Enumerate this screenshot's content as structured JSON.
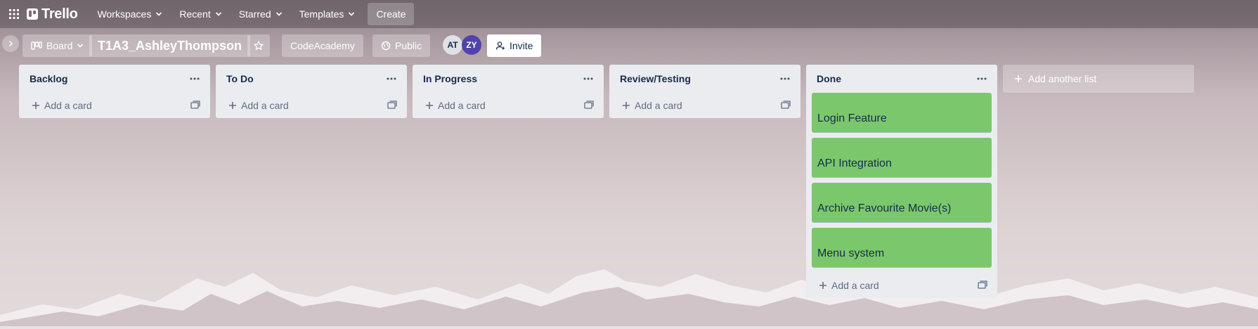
{
  "nav": {
    "logo_text": "Trello",
    "items": [
      {
        "label": "Workspaces"
      },
      {
        "label": "Recent"
      },
      {
        "label": "Starred"
      },
      {
        "label": "Templates"
      }
    ],
    "create_label": "Create"
  },
  "board": {
    "view_label": "Board",
    "title": "T1A3_AshleyThompson",
    "workspace_label": "CodeAcademy",
    "visibility_label": "Public",
    "members": [
      {
        "initials": "AT",
        "color": "#dfe1e6",
        "text_color": "#172b4d"
      },
      {
        "initials": "ZY",
        "color": "#5243aa",
        "text_color": "#ffffff"
      }
    ],
    "invite_label": "Invite"
  },
  "lists": [
    {
      "title": "Backlog",
      "cards": [],
      "add_label": "Add a card"
    },
    {
      "title": "To Do",
      "cards": [],
      "add_label": "Add a card"
    },
    {
      "title": "In Progress",
      "cards": [],
      "add_label": "Add a card"
    },
    {
      "title": "Review/Testing",
      "cards": [],
      "add_label": "Add a card"
    },
    {
      "title": "Done",
      "cards": [
        {
          "title": "Login Feature"
        },
        {
          "title": "API Integration"
        },
        {
          "title": "Archive Favourite Movie(s)"
        },
        {
          "title": "Menu system"
        }
      ],
      "add_label": "Add a card"
    }
  ],
  "add_list_label": "Add another list",
  "colors": {
    "card_label_green": "#7bc86c",
    "list_bg": "#ebecf0"
  }
}
